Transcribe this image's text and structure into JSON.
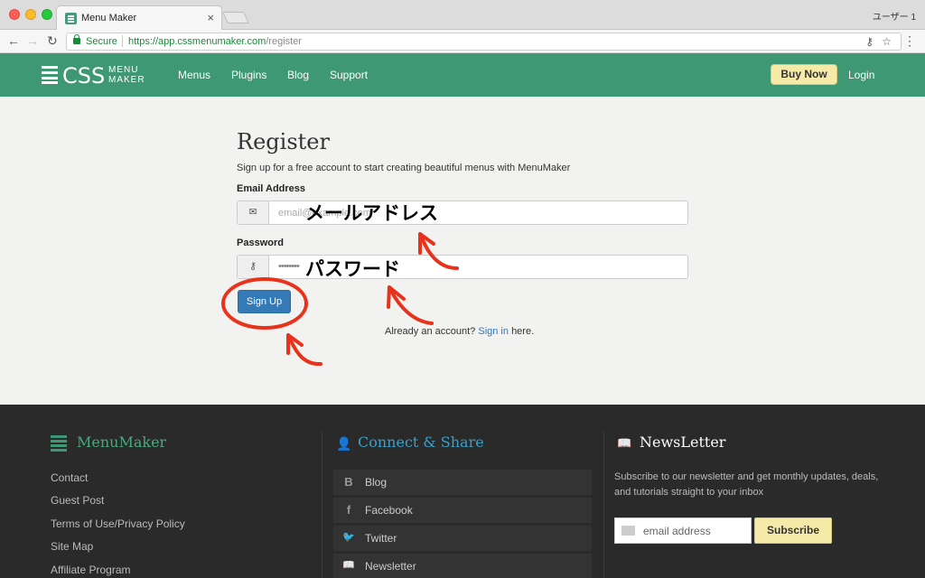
{
  "browser": {
    "tab_title": "Menu Maker",
    "tab_close": "×",
    "profile": "ユーザー 1",
    "secure_label": "Secure",
    "url_host": "https://app.cssmenumaker.com",
    "url_path": "/register",
    "back_glyph": "←",
    "forward_glyph": "→",
    "reload_glyph": "↻",
    "key_glyph": "⚷",
    "star_glyph": "☆",
    "menu_glyph": "⋮"
  },
  "header": {
    "logo_css": "CSS",
    "logo_menu": "MENU",
    "logo_maker": "MAKER",
    "nav": [
      "Menus",
      "Plugins",
      "Blog",
      "Support"
    ],
    "buy_now": "Buy Now",
    "login": "Login",
    "accent_color": "#3e9874"
  },
  "register": {
    "title": "Register",
    "subtitle": "Sign up for a free account to start creating beautiful menus with MenuMaker",
    "email_label": "Email Address",
    "email_placeholder": "email@example.com",
    "email_icon": "✉",
    "password_label": "Password",
    "password_value": "••••••••",
    "password_icon": "⚷",
    "signup": "Sign Up",
    "already_prefix": "Already an account?",
    "signin_link": "Sign in",
    "already_suffix": "here."
  },
  "annotations": {
    "email_jp": "メールアドレス",
    "password_jp": "パスワード",
    "color": "#e8321c"
  },
  "footer": {
    "menumaker_heading": "MenuMaker",
    "links": [
      "Contact",
      "Guest Post",
      "Terms of Use/Privacy Policy",
      "Site Map",
      "Affiliate Program"
    ],
    "connect_heading": "Connect & Share",
    "social": [
      {
        "icon": "B",
        "label": "Blog"
      },
      {
        "icon": "f",
        "label": "Facebook"
      },
      {
        "icon": "🐦",
        "label": "Twitter"
      },
      {
        "icon": "📖",
        "label": "Newsletter"
      }
    ],
    "newsletter_heading": "NewsLetter",
    "newsletter_text": "Subscribe to our newsletter and get monthly updates, deals, and tutorials straight to your inbox",
    "email_placeholder": "email address",
    "subscribe": "Subscribe"
  }
}
